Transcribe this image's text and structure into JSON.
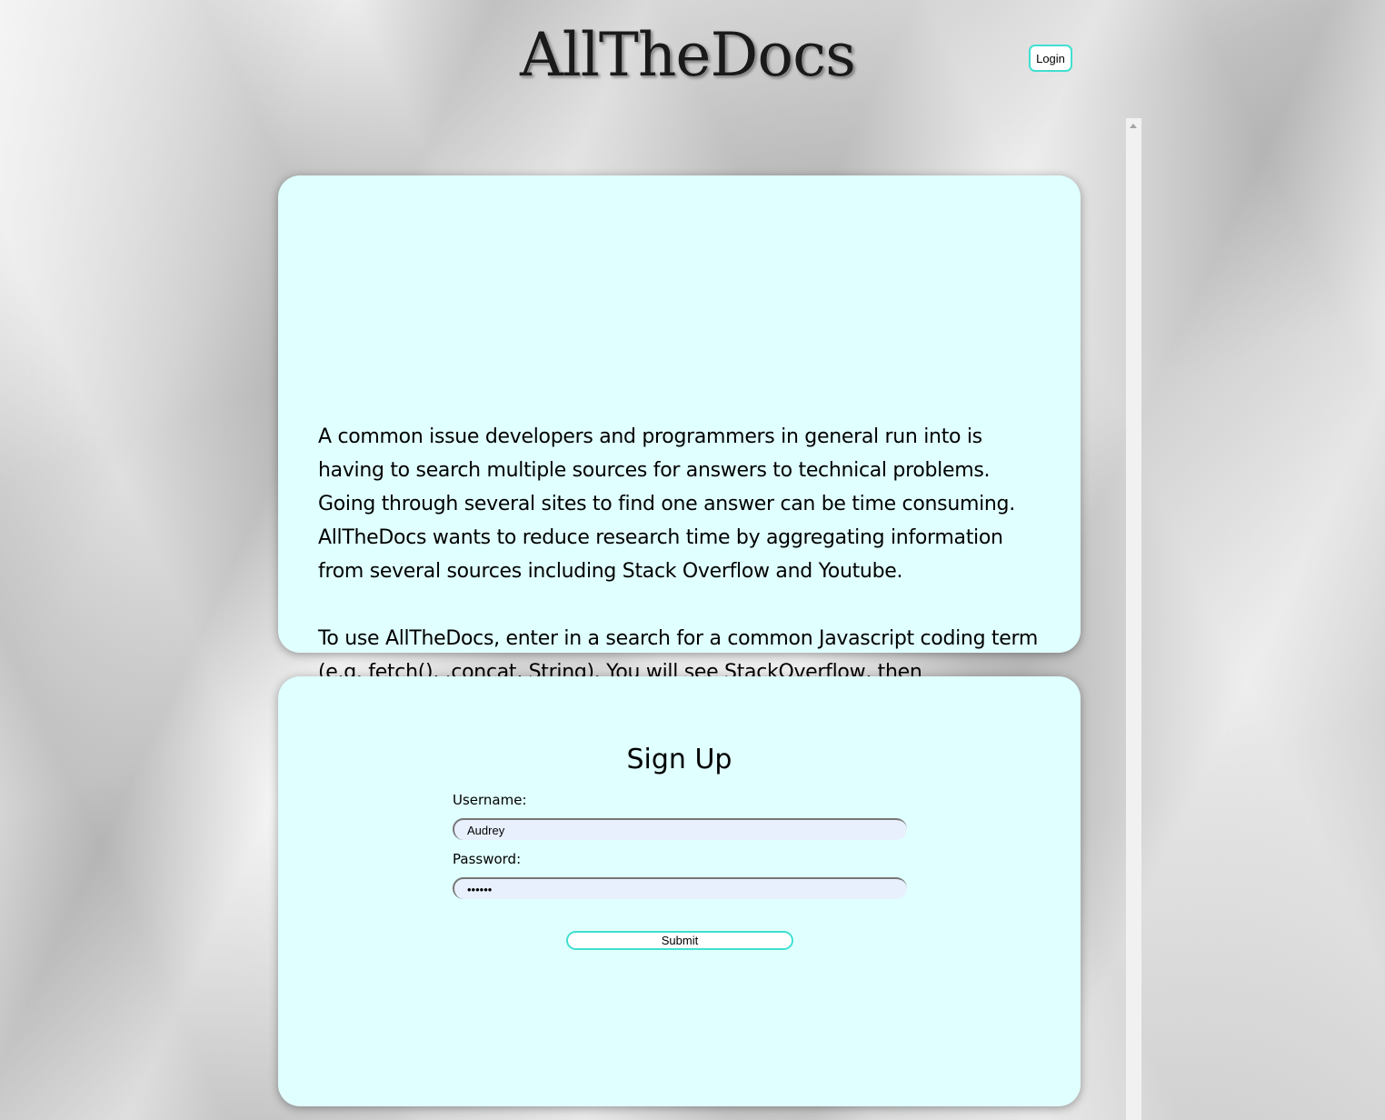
{
  "header": {
    "site_title": "AllTheDocs",
    "login_label": "Login"
  },
  "about": {
    "paragraphs": [
      "A common issue developers and programmers in general run into is having to search multiple sources for answers to technical problems. Going through several sites to find one answer can be time consuming. AllTheDocs wants to reduce research time by aggregating information from several sources including Stack Overflow and Youtube.",
      "To use AllTheDocs, enter in a search for a common Javascript coding term (e.g. fetch(), .concat, String). You will see StackOverflow, then Documentation from MDN and React, and finally get videos from Youtube."
    ]
  },
  "signup": {
    "title": "Sign Up",
    "username_label": "Username:",
    "username_value": "Audrey",
    "password_label": "Password:",
    "password_value": "123456",
    "submit_label": "Submit"
  },
  "colors": {
    "card_background": "#e0ffff",
    "button_border": "#40e0d0",
    "input_background": "#e8f0fe"
  }
}
